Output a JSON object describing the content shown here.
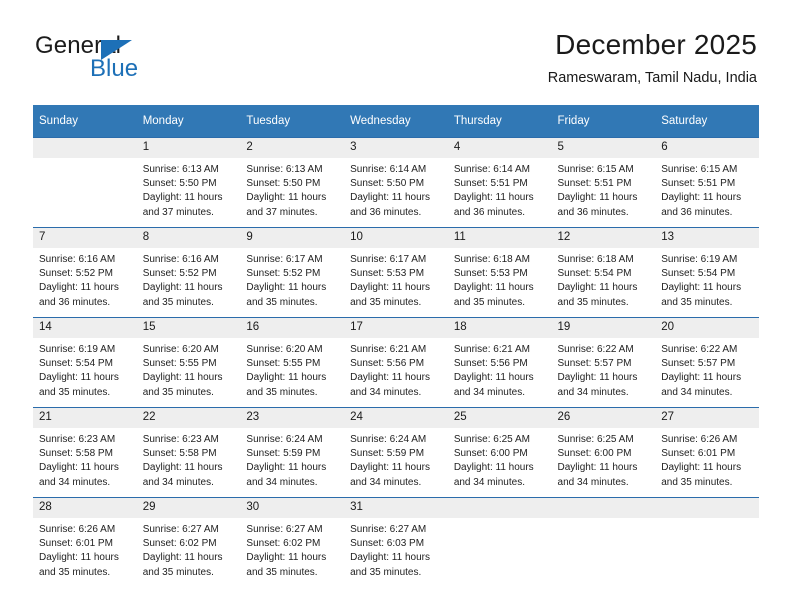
{
  "brand": {
    "name_part1": "General",
    "name_part2": "Blue",
    "triangle_color": "#1d70b7"
  },
  "header": {
    "title": "December 2025",
    "subtitle": "Rameswaram, Tamil Nadu, India"
  },
  "theme": {
    "header_bg": "#3178b5",
    "daynum_bg": "#eeeeee",
    "rule_color": "#2b6cab"
  },
  "weekday_headers": [
    "Sunday",
    "Monday",
    "Tuesday",
    "Wednesday",
    "Thursday",
    "Friday",
    "Saturday"
  ],
  "weeks": [
    [
      {
        "day": "",
        "lines": []
      },
      {
        "day": "1",
        "lines": [
          "Sunrise: 6:13 AM",
          "Sunset: 5:50 PM",
          "Daylight: 11 hours",
          "and 37 minutes."
        ]
      },
      {
        "day": "2",
        "lines": [
          "Sunrise: 6:13 AM",
          "Sunset: 5:50 PM",
          "Daylight: 11 hours",
          "and 37 minutes."
        ]
      },
      {
        "day": "3",
        "lines": [
          "Sunrise: 6:14 AM",
          "Sunset: 5:50 PM",
          "Daylight: 11 hours",
          "and 36 minutes."
        ]
      },
      {
        "day": "4",
        "lines": [
          "Sunrise: 6:14 AM",
          "Sunset: 5:51 PM",
          "Daylight: 11 hours",
          "and 36 minutes."
        ]
      },
      {
        "day": "5",
        "lines": [
          "Sunrise: 6:15 AM",
          "Sunset: 5:51 PM",
          "Daylight: 11 hours",
          "and 36 minutes."
        ]
      },
      {
        "day": "6",
        "lines": [
          "Sunrise: 6:15 AM",
          "Sunset: 5:51 PM",
          "Daylight: 11 hours",
          "and 36 minutes."
        ]
      }
    ],
    [
      {
        "day": "7",
        "lines": [
          "Sunrise: 6:16 AM",
          "Sunset: 5:52 PM",
          "Daylight: 11 hours",
          "and 36 minutes."
        ]
      },
      {
        "day": "8",
        "lines": [
          "Sunrise: 6:16 AM",
          "Sunset: 5:52 PM",
          "Daylight: 11 hours",
          "and 35 minutes."
        ]
      },
      {
        "day": "9",
        "lines": [
          "Sunrise: 6:17 AM",
          "Sunset: 5:52 PM",
          "Daylight: 11 hours",
          "and 35 minutes."
        ]
      },
      {
        "day": "10",
        "lines": [
          "Sunrise: 6:17 AM",
          "Sunset: 5:53 PM",
          "Daylight: 11 hours",
          "and 35 minutes."
        ]
      },
      {
        "day": "11",
        "lines": [
          "Sunrise: 6:18 AM",
          "Sunset: 5:53 PM",
          "Daylight: 11 hours",
          "and 35 minutes."
        ]
      },
      {
        "day": "12",
        "lines": [
          "Sunrise: 6:18 AM",
          "Sunset: 5:54 PM",
          "Daylight: 11 hours",
          "and 35 minutes."
        ]
      },
      {
        "day": "13",
        "lines": [
          "Sunrise: 6:19 AM",
          "Sunset: 5:54 PM",
          "Daylight: 11 hours",
          "and 35 minutes."
        ]
      }
    ],
    [
      {
        "day": "14",
        "lines": [
          "Sunrise: 6:19 AM",
          "Sunset: 5:54 PM",
          "Daylight: 11 hours",
          "and 35 minutes."
        ]
      },
      {
        "day": "15",
        "lines": [
          "Sunrise: 6:20 AM",
          "Sunset: 5:55 PM",
          "Daylight: 11 hours",
          "and 35 minutes."
        ]
      },
      {
        "day": "16",
        "lines": [
          "Sunrise: 6:20 AM",
          "Sunset: 5:55 PM",
          "Daylight: 11 hours",
          "and 35 minutes."
        ]
      },
      {
        "day": "17",
        "lines": [
          "Sunrise: 6:21 AM",
          "Sunset: 5:56 PM",
          "Daylight: 11 hours",
          "and 34 minutes."
        ]
      },
      {
        "day": "18",
        "lines": [
          "Sunrise: 6:21 AM",
          "Sunset: 5:56 PM",
          "Daylight: 11 hours",
          "and 34 minutes."
        ]
      },
      {
        "day": "19",
        "lines": [
          "Sunrise: 6:22 AM",
          "Sunset: 5:57 PM",
          "Daylight: 11 hours",
          "and 34 minutes."
        ]
      },
      {
        "day": "20",
        "lines": [
          "Sunrise: 6:22 AM",
          "Sunset: 5:57 PM",
          "Daylight: 11 hours",
          "and 34 minutes."
        ]
      }
    ],
    [
      {
        "day": "21",
        "lines": [
          "Sunrise: 6:23 AM",
          "Sunset: 5:58 PM",
          "Daylight: 11 hours",
          "and 34 minutes."
        ]
      },
      {
        "day": "22",
        "lines": [
          "Sunrise: 6:23 AM",
          "Sunset: 5:58 PM",
          "Daylight: 11 hours",
          "and 34 minutes."
        ]
      },
      {
        "day": "23",
        "lines": [
          "Sunrise: 6:24 AM",
          "Sunset: 5:59 PM",
          "Daylight: 11 hours",
          "and 34 minutes."
        ]
      },
      {
        "day": "24",
        "lines": [
          "Sunrise: 6:24 AM",
          "Sunset: 5:59 PM",
          "Daylight: 11 hours",
          "and 34 minutes."
        ]
      },
      {
        "day": "25",
        "lines": [
          "Sunrise: 6:25 AM",
          "Sunset: 6:00 PM",
          "Daylight: 11 hours",
          "and 34 minutes."
        ]
      },
      {
        "day": "26",
        "lines": [
          "Sunrise: 6:25 AM",
          "Sunset: 6:00 PM",
          "Daylight: 11 hours",
          "and 34 minutes."
        ]
      },
      {
        "day": "27",
        "lines": [
          "Sunrise: 6:26 AM",
          "Sunset: 6:01 PM",
          "Daylight: 11 hours",
          "and 35 minutes."
        ]
      }
    ],
    [
      {
        "day": "28",
        "lines": [
          "Sunrise: 6:26 AM",
          "Sunset: 6:01 PM",
          "Daylight: 11 hours",
          "and 35 minutes."
        ]
      },
      {
        "day": "29",
        "lines": [
          "Sunrise: 6:27 AM",
          "Sunset: 6:02 PM",
          "Daylight: 11 hours",
          "and 35 minutes."
        ]
      },
      {
        "day": "30",
        "lines": [
          "Sunrise: 6:27 AM",
          "Sunset: 6:02 PM",
          "Daylight: 11 hours",
          "and 35 minutes."
        ]
      },
      {
        "day": "31",
        "lines": [
          "Sunrise: 6:27 AM",
          "Sunset: 6:03 PM",
          "Daylight: 11 hours",
          "and 35 minutes."
        ]
      },
      {
        "day": "",
        "lines": []
      },
      {
        "day": "",
        "lines": []
      },
      {
        "day": "",
        "lines": []
      }
    ]
  ]
}
